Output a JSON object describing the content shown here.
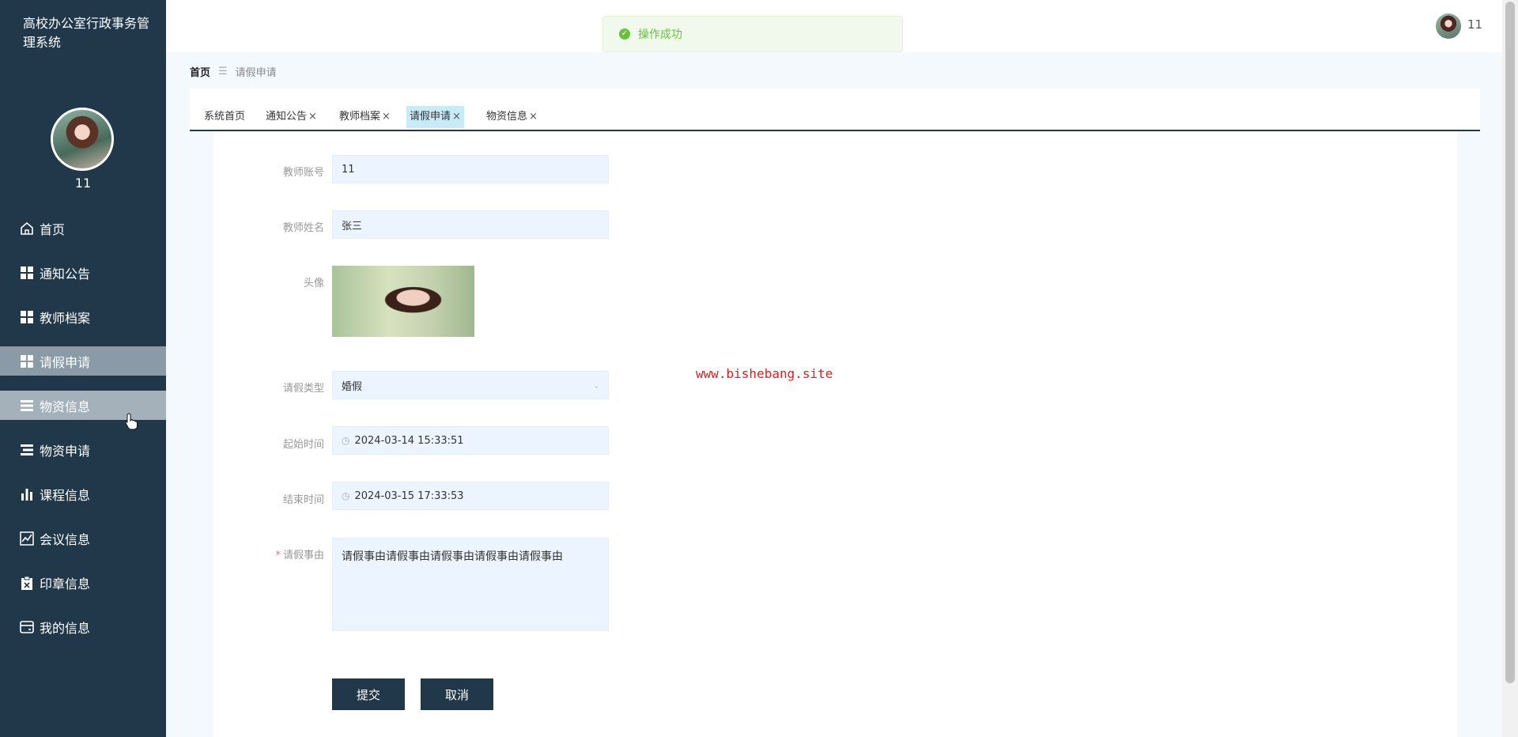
{
  "app": {
    "title": "高校办公室行政事务管理系统"
  },
  "user": {
    "name": "11"
  },
  "sidebar": {
    "items": [
      {
        "label": "首页",
        "icon": "home-icon"
      },
      {
        "label": "通知公告",
        "icon": "grid-icon"
      },
      {
        "label": "教师档案",
        "icon": "grid-icon"
      },
      {
        "label": "请假申请",
        "icon": "grid-icon",
        "active": true
      },
      {
        "label": "物资信息",
        "icon": "list-icon",
        "hover": true
      },
      {
        "label": "物资申请",
        "icon": "list-icon"
      },
      {
        "label": "课程信息",
        "icon": "bar-chart-icon"
      },
      {
        "label": "会议信息",
        "icon": "line-chart-icon"
      },
      {
        "label": "印章信息",
        "icon": "clipboard-icon"
      },
      {
        "label": "我的信息",
        "icon": "card-icon"
      }
    ]
  },
  "toast": {
    "message": "操作成功",
    "type": "success"
  },
  "breadcrumb": {
    "home": "首页",
    "current": "请假申请"
  },
  "tabs": [
    {
      "label": "系统首页",
      "closable": false
    },
    {
      "label": "通知公告",
      "closable": true
    },
    {
      "label": "教师档案",
      "closable": true
    },
    {
      "label": "请假申请",
      "closable": true,
      "active": true
    },
    {
      "label": "物资信息",
      "closable": true
    }
  ],
  "tab_close_glyph": "×",
  "form": {
    "teacher_account": {
      "label": "教师账号",
      "value": "11"
    },
    "teacher_name": {
      "label": "教师姓名",
      "value": "张三"
    },
    "avatar": {
      "label": "头像"
    },
    "leave_type": {
      "label": "请假类型",
      "value": "婚假"
    },
    "start_time": {
      "label": "起始时间",
      "value": "2024-03-14 15:33:51"
    },
    "end_time": {
      "label": "结束时间",
      "value": "2024-03-15 17:33:53"
    },
    "reason": {
      "label": "请假事由",
      "value": "请假事由请假事由请假事由请假事由请假事由",
      "required": true
    },
    "submit_label": "提交",
    "cancel_label": "取消"
  },
  "watermark": "www.bishebang.site",
  "colors": {
    "sidebar": "#20384a",
    "accent": "#20384a",
    "field_bg": "#ecf5ff",
    "success": "#67c23a",
    "watermark": "#e02020"
  }
}
